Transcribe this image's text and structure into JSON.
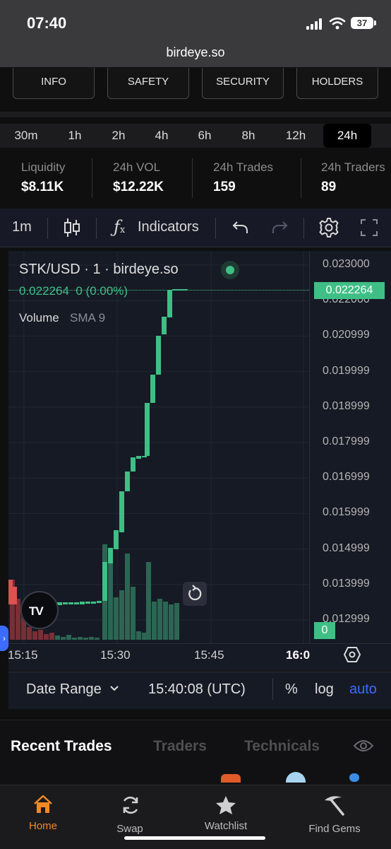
{
  "status": {
    "time": "07:40",
    "battery": "37"
  },
  "browser": {
    "url": "birdeye.so"
  },
  "top_tabs": [
    "INFO",
    "SAFETY",
    "SECURITY",
    "HOLDERS"
  ],
  "timeframes": {
    "items": [
      "30m",
      "1h",
      "2h",
      "4h",
      "6h",
      "8h",
      "12h",
      "24h"
    ],
    "active": "24h"
  },
  "stats": [
    {
      "label": "Liquidity",
      "value": "$8.11K"
    },
    {
      "label": "24h VOL",
      "value": "$12.22K"
    },
    {
      "label": "24h Trades",
      "value": "159"
    },
    {
      "label": "24h Traders",
      "value": "89"
    }
  ],
  "toolbar": {
    "interval": "1m",
    "indicators": "Indicators"
  },
  "legend": {
    "symbol": "STK/USD · 1 · birdeye.so",
    "price_line": "0.022264  0 (0.00%)",
    "volume_label": "Volume",
    "sma_label": "SMA 9"
  },
  "price_axis": {
    "ticks": [
      "0.023000",
      "0.022000",
      "0.020999",
      "0.019999",
      "0.018999",
      "0.017999",
      "0.016999",
      "0.015999",
      "0.014999",
      "0.013999",
      "0.012999"
    ],
    "last_price_badge": "0.022264",
    "volume_badge": "0"
  },
  "time_axis": {
    "ticks": [
      "15:15",
      "15:30",
      "15:45",
      "16:0"
    ]
  },
  "bottom_bar": {
    "date_range": "Date Range",
    "clock": "15:40:08 (UTC)",
    "percent": "%",
    "log": "log",
    "auto": "auto"
  },
  "section_tabs": [
    "Recent Trades",
    "Traders",
    "Technicals"
  ],
  "nav": [
    "Home",
    "Swap",
    "Watchlist",
    "Find Gems"
  ],
  "colors": {
    "up": "#3fbf85",
    "down": "#d9534f",
    "accent": "#f08a24",
    "auto_blue": "#3b6cff"
  }
}
